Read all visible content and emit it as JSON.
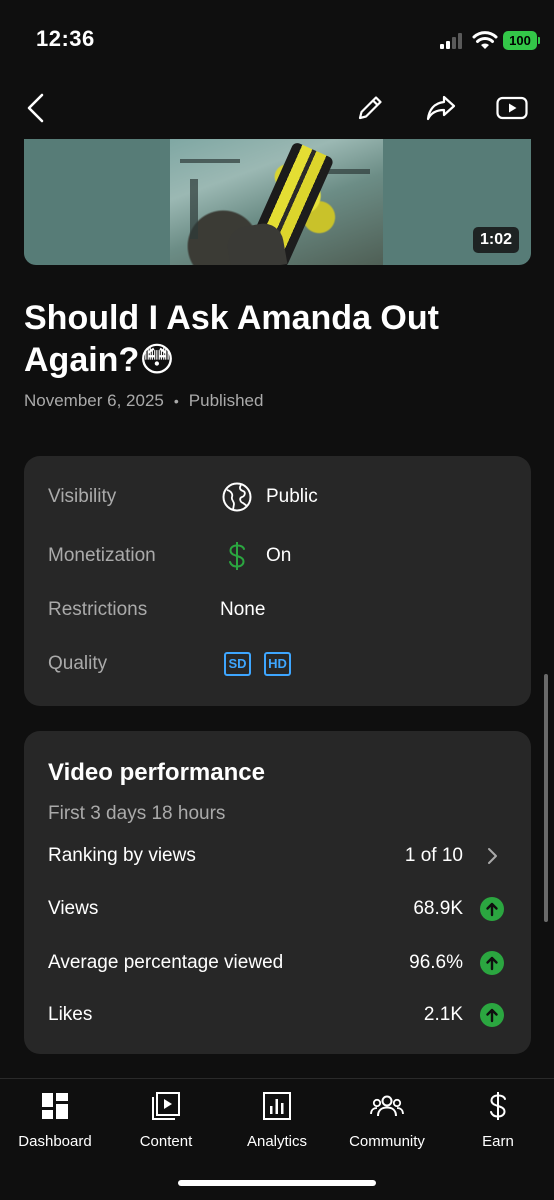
{
  "status_bar": {
    "time": "12:36",
    "battery": "100"
  },
  "topnav": {
    "back_icon": "chevron-left-icon",
    "edit_icon": "pencil-icon",
    "share_icon": "share-icon",
    "youtube_icon": "youtube-play-icon"
  },
  "video": {
    "duration": "1:02",
    "title": "Should I Ask Amanda Out Again?😳",
    "date": "November 6, 2025",
    "separator": "•",
    "status": "Published"
  },
  "details": {
    "visibility": {
      "label": "Visibility",
      "value": "Public",
      "icon": "globe-icon"
    },
    "monetization": {
      "label": "Monetization",
      "value": "On",
      "icon": "dollar-icon",
      "color": "#2ba640"
    },
    "restrictions": {
      "label": "Restrictions",
      "value": "None"
    },
    "quality": {
      "label": "Quality",
      "badges": [
        "SD",
        "HD"
      ],
      "color": "#3ea6ff"
    }
  },
  "performance": {
    "title": "Video performance",
    "subtitle": "First 3 days 18 hours",
    "rows": [
      {
        "label": "Ranking by views",
        "value": "1 of 10",
        "trail": "chevron-right-icon"
      },
      {
        "label": "Views",
        "value": "68.9K",
        "trail": "arrow-up-icon"
      },
      {
        "label": "Average percentage viewed",
        "value": "96.6%",
        "trail": "arrow-up-icon"
      },
      {
        "label": "Likes",
        "value": "2.1K",
        "trail": "arrow-up-icon"
      }
    ],
    "up_color": "#2ba640"
  },
  "bottom_nav": {
    "tabs": [
      {
        "label": "Dashboard",
        "icon": "dashboard-icon"
      },
      {
        "label": "Content",
        "icon": "content-icon"
      },
      {
        "label": "Analytics",
        "icon": "analytics-icon"
      },
      {
        "label": "Community",
        "icon": "community-icon"
      },
      {
        "label": "Earn",
        "icon": "dollar-icon"
      }
    ]
  }
}
